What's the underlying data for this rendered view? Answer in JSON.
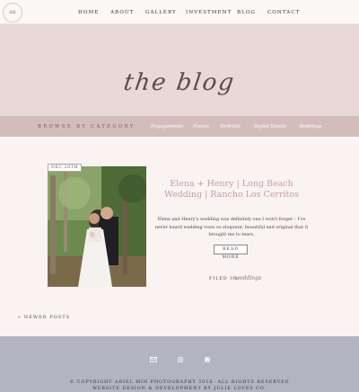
{
  "logo": {
    "text": "aa"
  },
  "nav": {
    "items": [
      "HOME",
      "ABOUT",
      "GALLERY",
      "INVESTMENT",
      "BLOG",
      "CONTACT"
    ]
  },
  "hero": {
    "title": "the blog"
  },
  "categories": {
    "label": "BROWSE BY CATEGORY",
    "items": [
      "Engagements",
      "Events",
      "Portraits",
      "Styled Shoots",
      "Weddings"
    ]
  },
  "post": {
    "date": "DEC 28TH",
    "title": "Elena + Henry | Long Beach Wedding | Rancho Los Cerritos",
    "excerpt": "Elena and Henry's wedding was definitely one I won't forget – I've never heard wedding vows so eloquent, beautiful and original that it brought me to tears.",
    "read_more": "READ MORE",
    "filed_label": "FILED IN:",
    "filed_category": "weddings"
  },
  "pagination": {
    "newer": "« NEWER POSTS"
  },
  "footer": {
    "copyright": "© COPYRIGHT ARIEL MIN PHOTOGRAPHY 2018. ALL RIGHTS RESERVED",
    "credit": "WEBSITE DESIGN & DEVELOPMENT BY JULIE LOVES CO."
  }
}
